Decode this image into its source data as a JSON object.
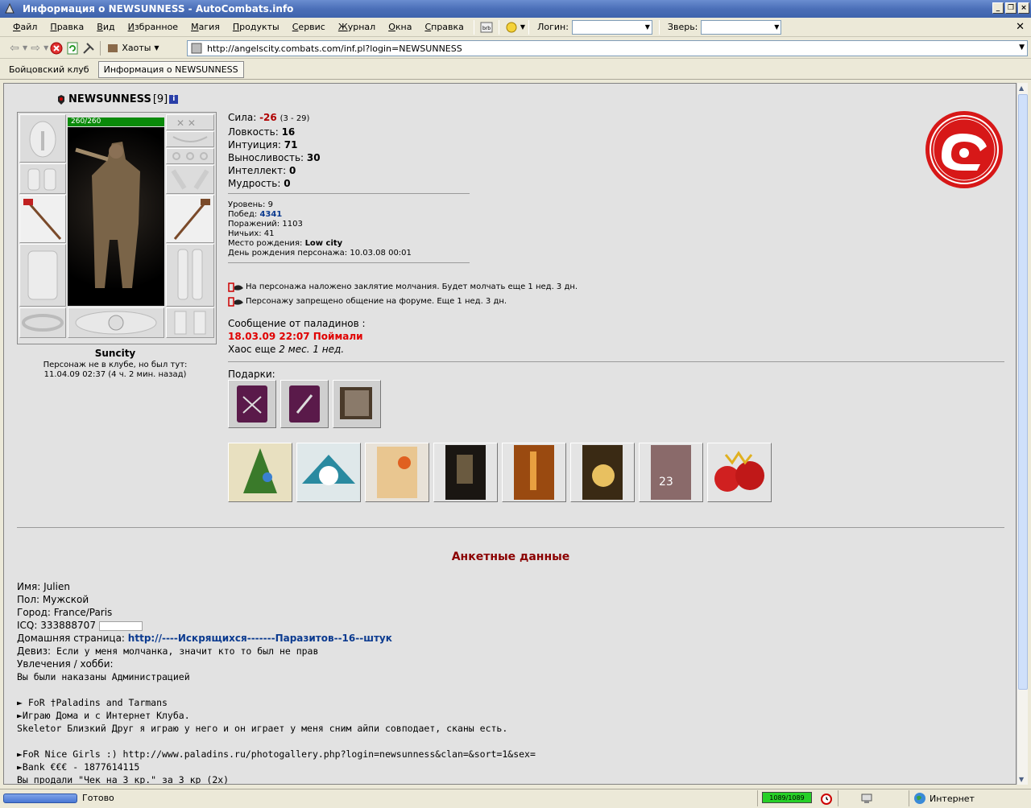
{
  "window": {
    "title": "Информация о NEWSUNNESS - AutoCombats.info"
  },
  "menu": {
    "items": [
      "Файл",
      "Правка",
      "Вид",
      "Избранное",
      "Магия",
      "Продукты",
      "Сервис",
      "Журнал",
      "Окна",
      "Справка"
    ],
    "login_label": "Логин:",
    "pet_label": "Зверь:",
    "clan_label": "Хаоты"
  },
  "address": {
    "url": "http://angelscity.combats.com/inf.pl?login=NEWSUNNESS"
  },
  "tabs": [
    {
      "label": "Бойцовский клуб",
      "active": false
    },
    {
      "label": "Информация о NEWSUNNESS",
      "active": true
    }
  ],
  "character": {
    "name": "NEWSUNNESS",
    "level": "[9]",
    "hp": "260/260",
    "city": "Suncity",
    "status_line1": "Персонаж не в клубе, но был тут:",
    "status_line2": "11.04.09 02:37 (4 ч. 2 мин. назад)"
  },
  "stats": {
    "strength_label": "Сила:",
    "strength": "-26",
    "strength_range": "(3 - 29)",
    "agility_label": "Ловкость:",
    "agility": "16",
    "intuition_label": "Интуиция:",
    "intuition": "71",
    "endurance_label": "Выносливость:",
    "endurance": "30",
    "intellect_label": "Интеллект:",
    "intellect": "0",
    "wisdom_label": "Мудрость:",
    "wisdom": "0"
  },
  "info": {
    "level_label": "Уровень:",
    "level": "9",
    "wins_label": "Побед:",
    "wins": "4341",
    "losses_label": "Поражений:",
    "losses": "1103",
    "draws_label": "Ничьих:",
    "draws": "41",
    "birthplace_label": "Место рождения:",
    "birthplace": "Low city",
    "birthday_label": "День рождения персонажа:",
    "birthday": "10.03.08 00:01"
  },
  "curses": [
    "На персонажа наложено заклятие молчания. Будет молчать еще 1 нед. 3 дн.",
    "Персонажу запрещено общение на форуме. Еще 1 нед. 3 дн."
  ],
  "paladin": {
    "label": "Сообщение от паладинов :",
    "message": "18.03.09 22:07 Поймали",
    "chaos_prefix": "Хаос еще",
    "chaos_time": "2 мес. 1 нед."
  },
  "gifts": {
    "label": "Подарки:",
    "row1_count": 3,
    "row2_count": 8
  },
  "anketa": {
    "title": "Анкетные данные",
    "name_label": "Имя:",
    "name": "Julien",
    "gender_label": "Пол:",
    "gender": "Мужской",
    "city_label": "Город:",
    "city": "France/Paris",
    "icq_label": "ICQ:",
    "icq": "333888707",
    "homepage_label": "Домашняя страница:",
    "homepage": "http://----Искрящихся-------Паразитов--16--штук",
    "motto_label": "Девиз:",
    "motto": "Если у меня молчанка, значит кто то был не прав",
    "hobby_label": "Увлечения / хобби:",
    "lines": [
      "Вы были наказаны Администрацией",
      "",
      "► FoR †Paladins and Tarmans",
      "►Играю Дома и с Интернет Клуба.",
      "Skeletor  Близкий Друг я играю у него и он играет у меня сним айпи совподает, сканы есть.",
      "",
      "►FoR Nice Girls :) http://www.paladins.ru/photogallery.php?login=newsunness&clan=&sort=1&sex=",
      "►Bank €€€ - 1877614115",
      "Вы продали \"Чек на 3 кр.\" за 3 кр (2x)"
    ]
  },
  "statusbar": {
    "text": "Готово",
    "memory": "1089/1089",
    "zone": "Интернет"
  },
  "colors": {
    "accent_red": "#e00000",
    "link_blue": "#0b3a8f",
    "title_dark_red": "#8b0000",
    "hp_green": "#0a8a0a"
  }
}
